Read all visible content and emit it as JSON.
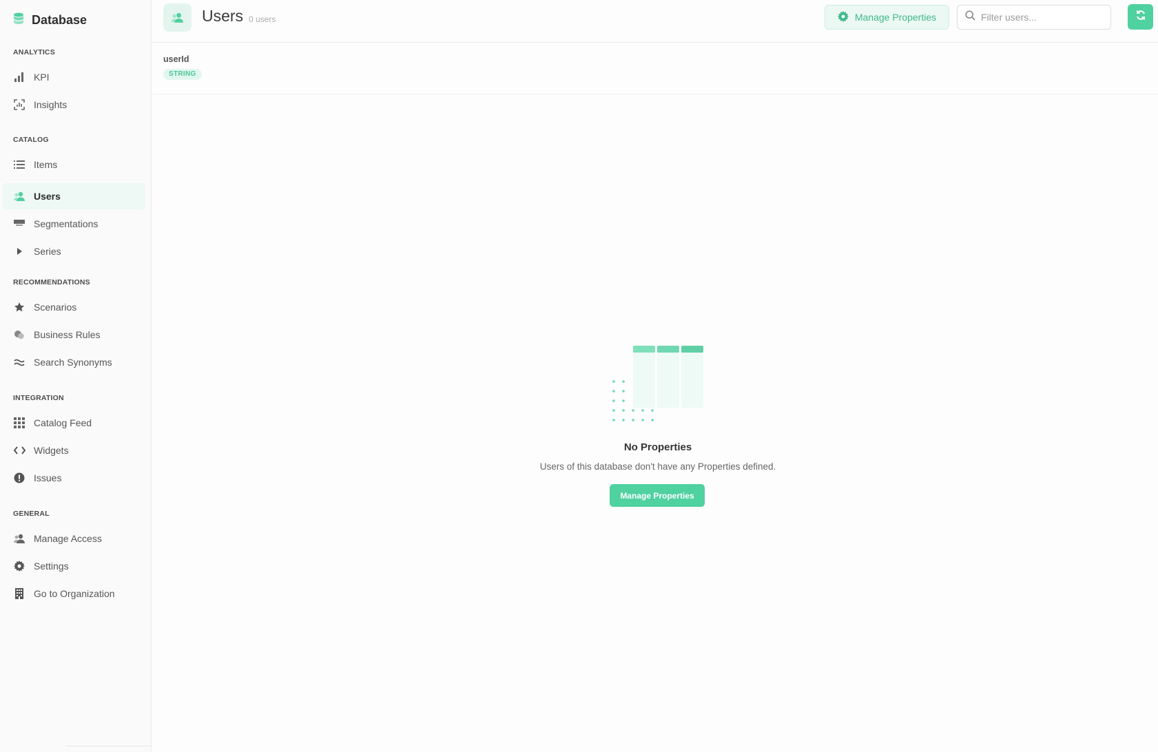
{
  "app": {
    "title": "Database"
  },
  "sidebar": {
    "sections": [
      {
        "label": "ANALYTICS"
      },
      {
        "label": "CATALOG"
      },
      {
        "label": "RECOMMENDATIONS"
      },
      {
        "label": "INTEGRATION"
      },
      {
        "label": "GENERAL"
      }
    ],
    "items": [
      {
        "label": "KPI",
        "icon": "bar-chart-icon"
      },
      {
        "label": "Insights",
        "icon": "insights-icon"
      },
      {
        "label": "Items",
        "icon": "list-icon"
      },
      {
        "label": "Users",
        "icon": "users-icon",
        "active": true
      },
      {
        "label": "Segmentations",
        "icon": "segmentation-icon"
      },
      {
        "label": "Series",
        "icon": "play-icon"
      },
      {
        "label": "Scenarios",
        "icon": "star-icon"
      },
      {
        "label": "Business Rules",
        "icon": "business-rules-icon"
      },
      {
        "label": "Search Synonyms",
        "icon": "approx-icon"
      },
      {
        "label": "Catalog Feed",
        "icon": "grid-icon"
      },
      {
        "label": "Widgets",
        "icon": "code-icon"
      },
      {
        "label": "Issues",
        "icon": "alert-icon"
      },
      {
        "label": "Manage Access",
        "icon": "users-icon"
      },
      {
        "label": "Settings",
        "icon": "gear-icon"
      },
      {
        "label": "Go to Organization",
        "icon": "building-icon"
      }
    ]
  },
  "header": {
    "title": "Users",
    "count": "0 users",
    "manage_button": "Manage Properties",
    "search_placeholder": "Filter users..."
  },
  "properties": [
    {
      "name": "userId",
      "type": "STRING"
    }
  ],
  "empty_state": {
    "title": "No Properties",
    "description": "Users of this database don't have any Properties defined.",
    "button": "Manage Properties"
  },
  "colors": {
    "accent": "#4fd1a0",
    "accent_light": "#e3f5ee",
    "text": "#333333"
  }
}
